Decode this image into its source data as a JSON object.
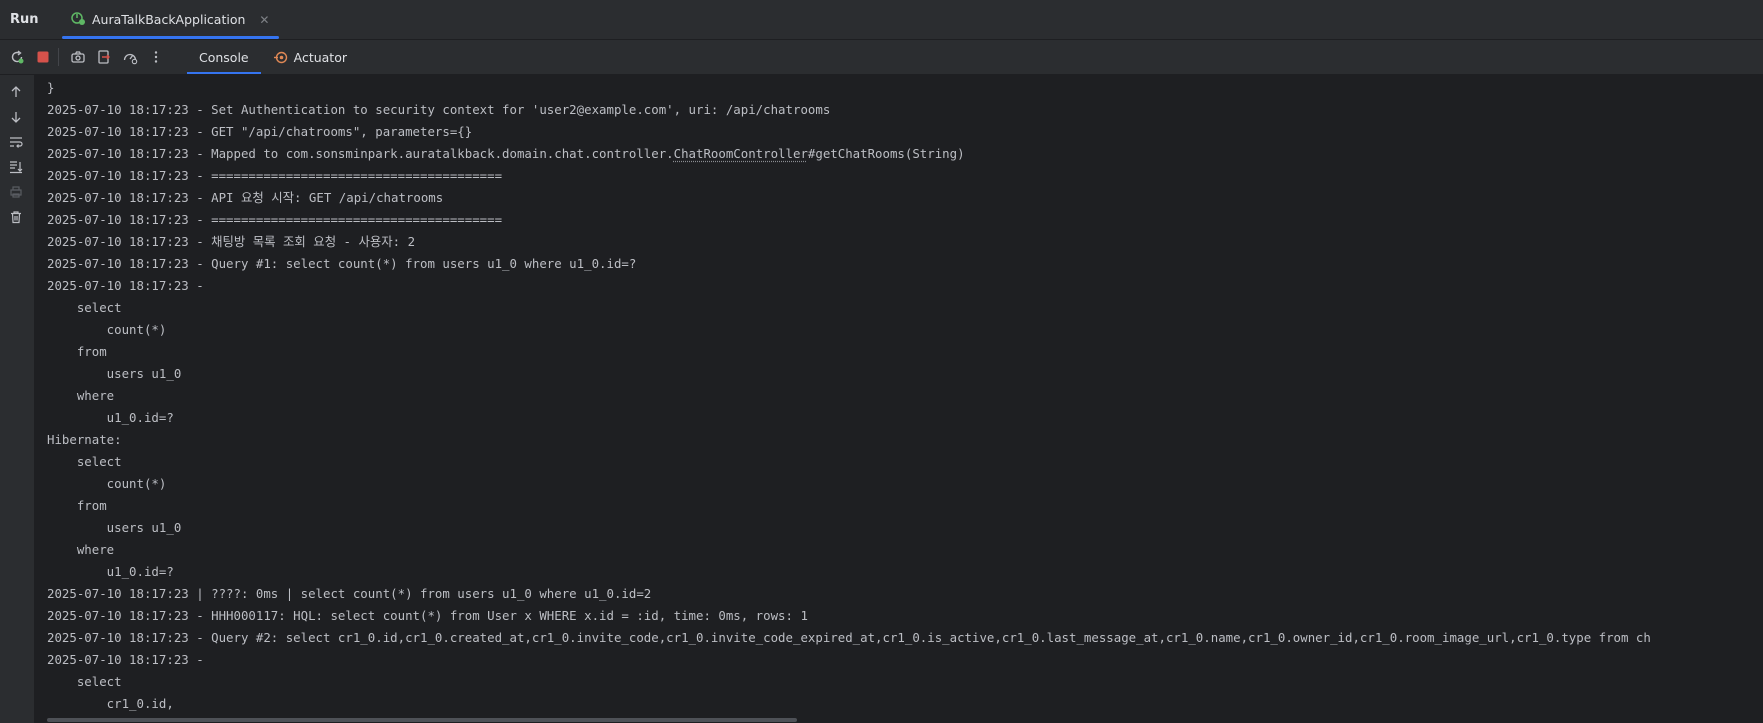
{
  "run_panel": {
    "title": "Run",
    "tab_label": "AuraTalkBackApplication",
    "close_glyph": "✕"
  },
  "console_tabs": {
    "console": "Console",
    "actuator": "Actuator"
  },
  "colors": {
    "accent": "#3574f0",
    "background": "#1e1f22",
    "panel": "#2b2d30",
    "text": "#bcbec4",
    "stop_red": "#d6524b",
    "run_green": "#5fb865",
    "actuator_orange": "#e08855"
  },
  "icons": {
    "toolbar": [
      "rerun-icon",
      "stop-icon",
      "camera-icon",
      "exit-icon",
      "gauge-icon",
      "more-icon"
    ],
    "sidebar": [
      "arrow-up-icon",
      "arrow-down-icon",
      "soft-wrap-icon",
      "scroll-to-end-icon",
      "print-icon",
      "trash-icon"
    ]
  },
  "console_lines": [
    "}",
    "2025-07-10 18:17:23 - Set Authentication to security context for 'user2@example.com', uri: /api/chatrooms",
    "2025-07-10 18:17:23 - GET \"/api/chatrooms\", parameters={}",
    "2025-07-10 18:17:23 - Mapped to com.sonsminpark.auratalkback.domain.chat.controller.ChatRoomController#getChatRooms(String)",
    "2025-07-10 18:17:23 - =======================================",
    "2025-07-10 18:17:23 - API 요청 시작: GET /api/chatrooms",
    "2025-07-10 18:17:23 - =======================================",
    "2025-07-10 18:17:23 - 채팅방 목록 조회 요청 - 사용자: 2",
    "2025-07-10 18:17:23 - Query #1: select count(*) from users u1_0 where u1_0.id=?",
    "2025-07-10 18:17:23 -",
    "    select",
    "        count(*)",
    "    from",
    "        users u1_0",
    "    where",
    "        u1_0.id=?",
    "Hibernate:",
    "    select",
    "        count(*)",
    "    from",
    "        users u1_0",
    "    where",
    "        u1_0.id=?",
    "2025-07-10 18:17:23 | ????: 0ms | select count(*) from users u1_0 where u1_0.id=2",
    "2025-07-10 18:17:23 - HHH000117: HQL: select count(*) from User x WHERE x.id = :id, time: 0ms, rows: 1",
    "2025-07-10 18:17:23 - Query #2: select cr1_0.id,cr1_0.created_at,cr1_0.invite_code,cr1_0.invite_code_expired_at,cr1_0.is_active,cr1_0.last_message_at,cr1_0.name,cr1_0.owner_id,cr1_0.room_image_url,cr1_0.type from ch",
    "2025-07-10 18:17:23 -",
    "    select",
    "        cr1_0.id,"
  ]
}
